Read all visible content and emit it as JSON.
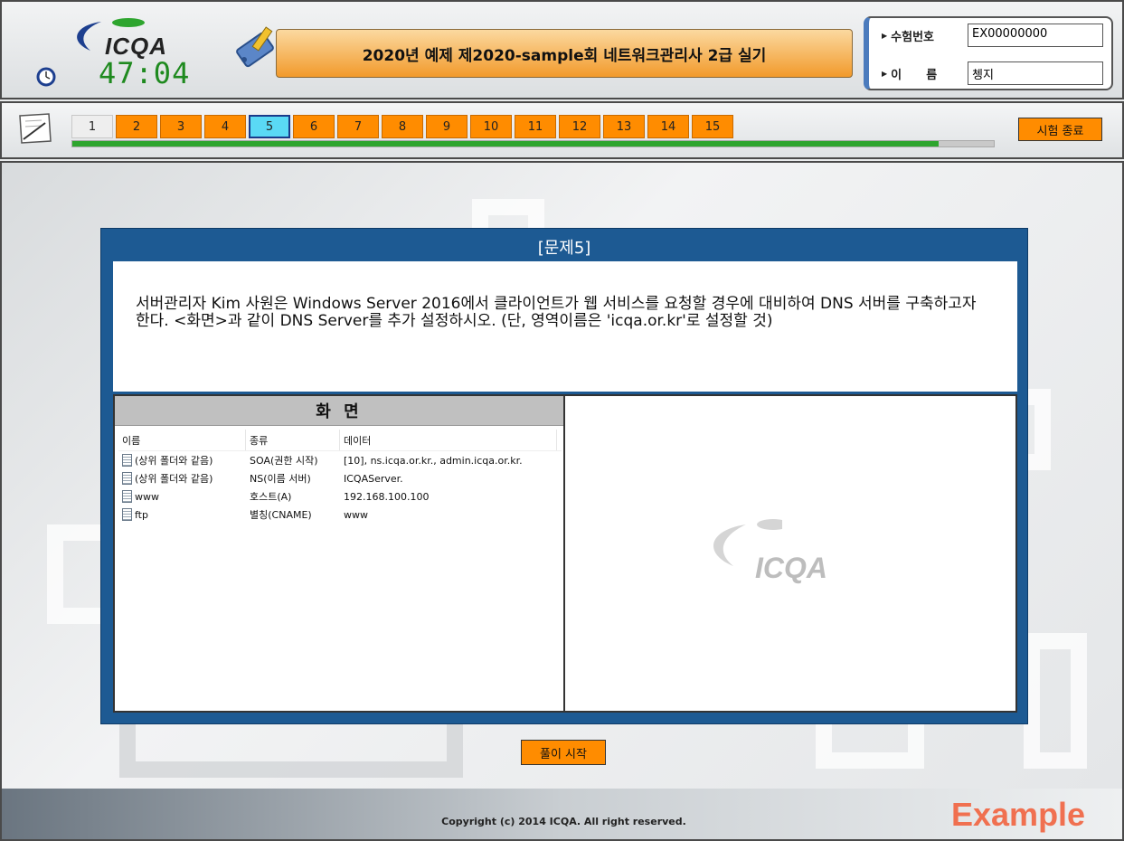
{
  "header": {
    "logo_text": "ICQA",
    "timer": "47:04",
    "exam_title": "2020년 예제 제2020-sample회 네트워크관리사 2급 실기",
    "exam_number_label": "수험번호",
    "exam_number_value": "EX00000000",
    "name_label": "이      름",
    "name_value": "쳉지"
  },
  "nav": {
    "questions": [
      "1",
      "2",
      "3",
      "4",
      "5",
      "6",
      "7",
      "8",
      "9",
      "10",
      "11",
      "12",
      "13",
      "14",
      "15"
    ],
    "current_question": 5,
    "progress_fraction": 0.94,
    "end_exam_label": "시험 종료"
  },
  "question": {
    "title": "[문제5]",
    "text": "서버관리자 Kim 사원은 Windows Server 2016에서 클라이언트가 웹 서비스를 요청할 경우에 대비하여 DNS 서버를 구축하고자 한다. <화면>과 같이 DNS Server를 추가 설정하시오. (단, 영역이름은 'icqa.or.kr'로 설정할 것)",
    "screen_header": "화 면",
    "columns": [
      "이름",
      "종류",
      "데이터"
    ],
    "records": [
      {
        "name": "(상위 폴더와 같음)",
        "type": "SOA(권한 시작)",
        "data": "[10], ns.icqa.or.kr., admin.icqa.or.kr."
      },
      {
        "name": "(상위 폴더와 같음)",
        "type": "NS(이름 서버)",
        "data": "ICQAServer."
      },
      {
        "name": "www",
        "type": "호스트(A)",
        "data": "192.168.100.100"
      },
      {
        "name": "ftp",
        "type": "별칭(CNAME)",
        "data": "www"
      }
    ],
    "watermark_text": "ICQA"
  },
  "start_button_label": "풀이 시작",
  "footer": {
    "copyright": "Copyright (c) 2014 ICQA. All right reserved.",
    "example_mark": "Example"
  },
  "colors": {
    "accent_orange": "#ff8c00",
    "panel_blue": "#1d5a93",
    "active_tab": "#5ad9f5",
    "progress_green": "#2ea52e"
  }
}
